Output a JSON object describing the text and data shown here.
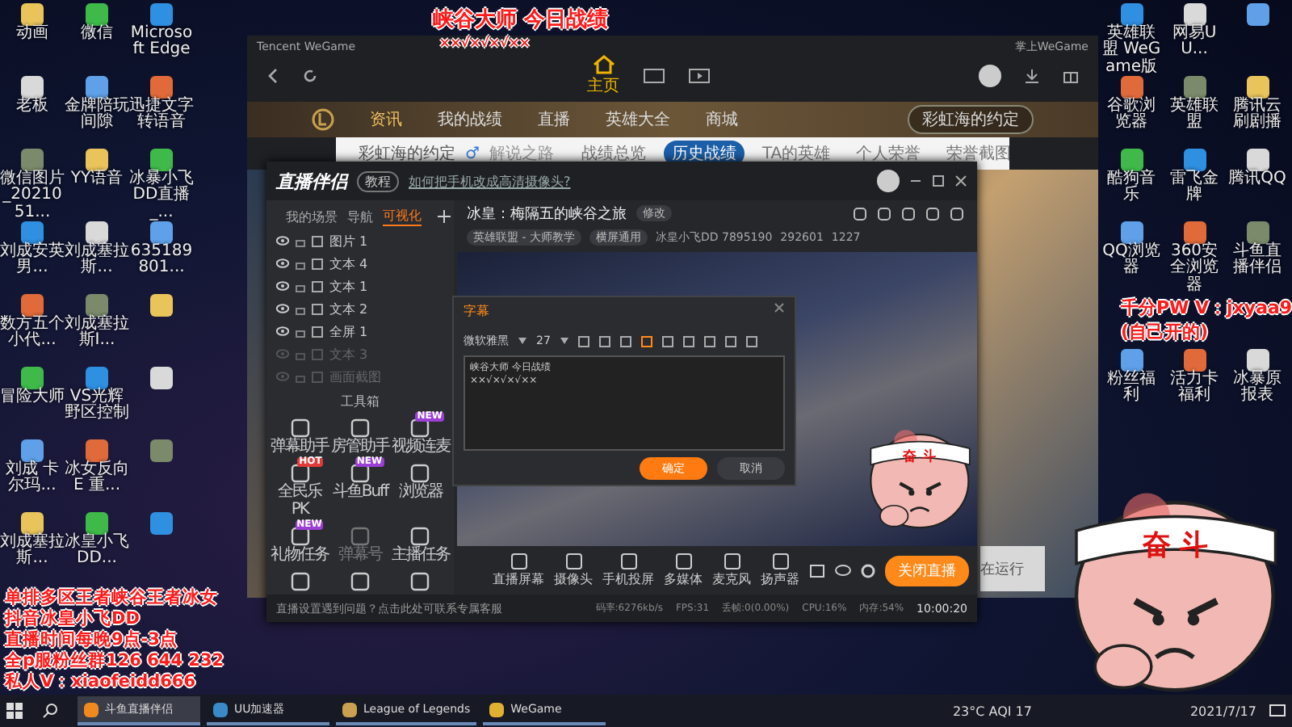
{
  "desktop_left": [
    [
      {
        "label": "动画"
      },
      {
        "label": "微信"
      },
      {
        "label": "Microsoft Edge"
      }
    ],
    [
      {
        "label": "老板"
      },
      {
        "label": "金牌陪玩间隙"
      },
      {
        "label": "迅捷文字转语音"
      }
    ],
    [
      {
        "label": "微信图片_2021051..."
      },
      {
        "label": "YY语音"
      },
      {
        "label": "冰暴小飞DD直播_..."
      }
    ],
    [
      {
        "label": "刘成安英男..."
      },
      {
        "label": "刘成塞拉斯..."
      },
      {
        "label": "635189801..."
      }
    ],
    [
      {
        "label": "数方五个小代..."
      },
      {
        "label": "刘成塞拉斯I..."
      }
    ],
    [
      {
        "label": "冒险大师"
      },
      {
        "label": "VS光辉野区控制"
      }
    ],
    [
      {
        "label": "刘成 卡尔玛..."
      },
      {
        "label": "冰女反向E 重..."
      }
    ],
    [
      {
        "label": "刘成塞拉斯..."
      },
      {
        "label": "冰皇小飞DD..."
      }
    ]
  ],
  "desktop_right": [
    [
      {
        "label": "英雄联盟 WeGame版"
      },
      {
        "label": "网易UU..."
      }
    ],
    [
      {
        "label": "谷歌浏览器"
      },
      {
        "label": "英雄联盟"
      },
      {
        "label": "腾讯云刷剧播"
      }
    ],
    [
      {
        "label": "酷狗音乐"
      },
      {
        "label": "雷飞金牌"
      },
      {
        "label": "腾讯QQ"
      }
    ],
    [
      {
        "label": "QQ浏览器"
      },
      {
        "label": "360安全浏览器"
      },
      {
        "label": "斗鱼直播伴侣"
      }
    ]
  ],
  "desktop_right_lower": [
    {
      "label": "粉丝福利"
    },
    {
      "label": "活力卡福利"
    }
  ],
  "desktop_file": {
    "label": "冰暴原报表"
  },
  "overlay": {
    "title": "峡谷大师 今日战绩",
    "marks": "××√×√×√××",
    "right_lines": [
      "千分PW V：jxyaa9",
      "(自己开的)"
    ],
    "left_lines": [
      "单排多区王者峡谷王者冰女",
      "抖音冰皇小飞DD",
      "直播时间每晚9点-3点",
      "全p服粉丝群126 644 232",
      "私人V：xiaofeidd666"
    ]
  },
  "wegame": {
    "title": "Tencent WeGame",
    "home_label": "主页",
    "account": "掌上WeGame",
    "site_nav": [
      {
        "label": "资讯",
        "selected": true
      },
      {
        "label": "我的战绩",
        "selected": false
      },
      {
        "label": "直播",
        "selected": false
      },
      {
        "label": "英雄大全",
        "selected": false
      },
      {
        "label": "商城",
        "selected": false
      }
    ],
    "search_value": "彩虹海的约定",
    "profile": {
      "name": "彩虹海的约定",
      "gender": "♂",
      "subtitle": "解说之路",
      "tabs": [
        {
          "label": "战绩总览",
          "selected": false
        },
        {
          "label": "历史战绩",
          "selected": true
        },
        {
          "label": "TA的英雄",
          "selected": false
        },
        {
          "label": "个人荣誉",
          "selected": false
        },
        {
          "label": "荣誉截图",
          "selected": false
        }
      ]
    }
  },
  "streamer": {
    "app_name": "直播伴侣",
    "tutorial": "教程",
    "tip_link": "如何把手机改成高清摄像头?",
    "sidebar_tabs": [
      {
        "label": "我的场景",
        "selected": false
      },
      {
        "label": "导航",
        "selected": false
      },
      {
        "label": "可视化",
        "selected": true
      }
    ],
    "layers": [
      {
        "label": "图片 1",
        "visible": true
      },
      {
        "label": "文本 4",
        "visible": true
      },
      {
        "label": "文本 1",
        "visible": true
      },
      {
        "label": "文本 2",
        "visible": true
      },
      {
        "label": "全屏 1",
        "visible": true
      },
      {
        "label": "文本 3",
        "visible": false
      },
      {
        "label": "画面截图",
        "visible": false
      }
    ],
    "toolbox_title": "工具箱",
    "tools": [
      {
        "label": "弹幕助手",
        "disabled": false
      },
      {
        "label": "房管助手",
        "disabled": false
      },
      {
        "label": "视频连麦",
        "badge": "NEW",
        "disabled": false
      },
      {
        "label": "全民乐PK",
        "badge": "HOT",
        "disabled": false
      },
      {
        "label": "斗鱼Buff",
        "badge": "NEW",
        "disabled": false
      },
      {
        "label": "浏览器",
        "disabled": false
      },
      {
        "label": "礼物任务",
        "badge": "NEW",
        "disabled": false
      },
      {
        "label": "弹幕号",
        "disabled": true
      },
      {
        "label": "主播任务",
        "disabled": false
      }
    ],
    "room_title": "冰皇：梅隔五的峡谷之旅",
    "edit_label": "修改",
    "category": "英雄联盟 - 大师教学",
    "layout_tag": "横屏通用",
    "host_info": "冰皇小飞DD 7895190",
    "hot": "292601",
    "fans": "1227",
    "sources": [
      {
        "label": "直播屏幕"
      },
      {
        "label": "摄像头"
      },
      {
        "label": "手机投屏"
      },
      {
        "label": "多媒体"
      },
      {
        "label": "麦克风"
      },
      {
        "label": "扬声器"
      }
    ],
    "stop_button": "关闭直播",
    "notice": "直播设置遇到问题？点击此处可联系专属客服",
    "stats": [
      "码率:6276kb/s",
      "FPS:31",
      "丢帧:0(0.00%)",
      "CPU:16%",
      "内存:54%"
    ],
    "timer": "10:00:20"
  },
  "dialog": {
    "title": "字幕",
    "font": "微软雅黑",
    "size": "27",
    "lines": [
      "峡谷大师 今日战绩",
      "××√×√×√××"
    ],
    "confirm": "确定",
    "cancel": "取消"
  },
  "behind_text": "在运行",
  "stickers": [
    {
      "headband": "奋 斗"
    },
    {
      "headband": "奋 斗"
    }
  ],
  "taskbar": {
    "apps": [
      {
        "label": "斗鱼直播伴侣",
        "selected": true
      },
      {
        "label": "UU加速器",
        "selected": false
      },
      {
        "label": "League of Legends",
        "selected": false
      },
      {
        "label": "WeGame",
        "selected": false
      }
    ],
    "weather": "23°C AQI 17",
    "date": "2021/7/17"
  }
}
